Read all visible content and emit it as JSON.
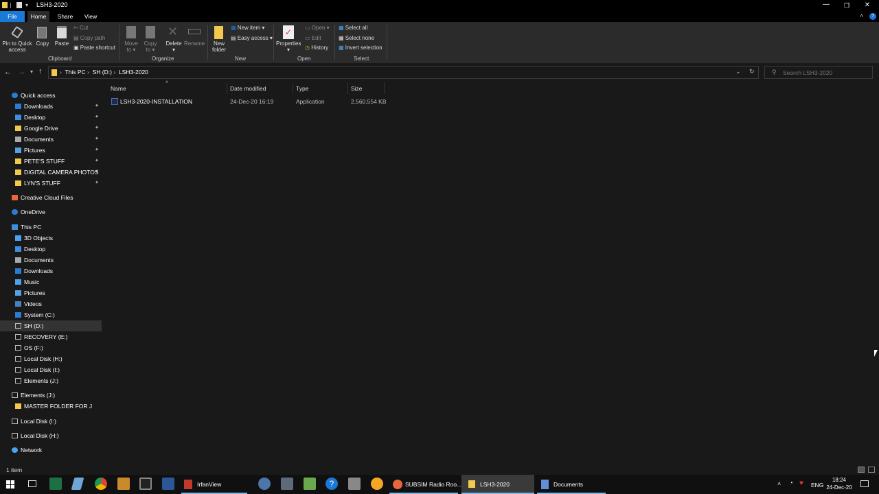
{
  "window": {
    "title": "LSH3-2020"
  },
  "tabs": [
    "File",
    "Home",
    "Share",
    "View"
  ],
  "ribbon": {
    "clipboard": {
      "pin": "Pin to Quick access",
      "copy": "Copy",
      "paste": "Paste",
      "cut": "Cut",
      "copy_path": "Copy path",
      "paste_shortcut": "Paste shortcut",
      "label": "Clipboard"
    },
    "organize": {
      "move_to": "Move to",
      "copy_to": "Copy to",
      "delete": "Delete",
      "rename": "Rename",
      "label": "Organize"
    },
    "new": {
      "new_folder": "New folder",
      "new_item": "New item",
      "easy_access": "Easy access",
      "label": "New"
    },
    "open": {
      "properties": "Properties",
      "open": "Open",
      "edit": "Edit",
      "history": "History",
      "label": "Open"
    },
    "select": {
      "select_all": "Select all",
      "select_none": "Select none",
      "invert": "Invert selection",
      "label": "Select"
    }
  },
  "address": {
    "crumbs": [
      "This PC",
      "SH (D:)",
      "LSH3-2020"
    ],
    "search_placeholder": "Search LSH3-2020"
  },
  "nav": {
    "quick_access": "Quick access",
    "quick_items": [
      "Downloads",
      "Desktop",
      "Google Drive",
      "Documents",
      "Pictures",
      "PETE'S STUFF",
      "DIGITAL CAMERA PHOTOS",
      "LYN'S STUFF"
    ],
    "creative_cloud": "Creative Cloud Files",
    "onedrive": "OneDrive",
    "this_pc": "This PC",
    "pc_items": [
      "3D Objects",
      "Desktop",
      "Documents",
      "Downloads",
      "Music",
      "Pictures",
      "Videos",
      "System (C:)",
      "SH  (D:)",
      "RECOVERY (E:)",
      "OS (F:)",
      "Local Disk (H:)",
      "Local Disk (I:)",
      "Elements (J:)"
    ],
    "elements": "Elements (J:)",
    "master_folder": "MASTER FOLDER FOR  J",
    "local_i": "Local Disk  (I:)",
    "local_h": "Local Disk (H:)",
    "network": "Network"
  },
  "columns": {
    "name": "Name",
    "date": "Date modified",
    "type": "Type",
    "size": "Size"
  },
  "files": [
    {
      "name": "LSH3-2020-INSTALLATION",
      "date": "24-Dec-20 16:19",
      "type": "Application",
      "size": "2,560,554 KB"
    }
  ],
  "status": "1 item",
  "taskbar": {
    "apps": [
      "IrfanView",
      "SUBSIM Radio Roo...",
      "LSH3-2020",
      "Documents"
    ],
    "lang": "ENG",
    "time": "18:24",
    "date": "24-Dec-20"
  },
  "colors": {
    "accent": "#1a78d6",
    "folder": "#f2c94c",
    "bg": "#191919"
  }
}
